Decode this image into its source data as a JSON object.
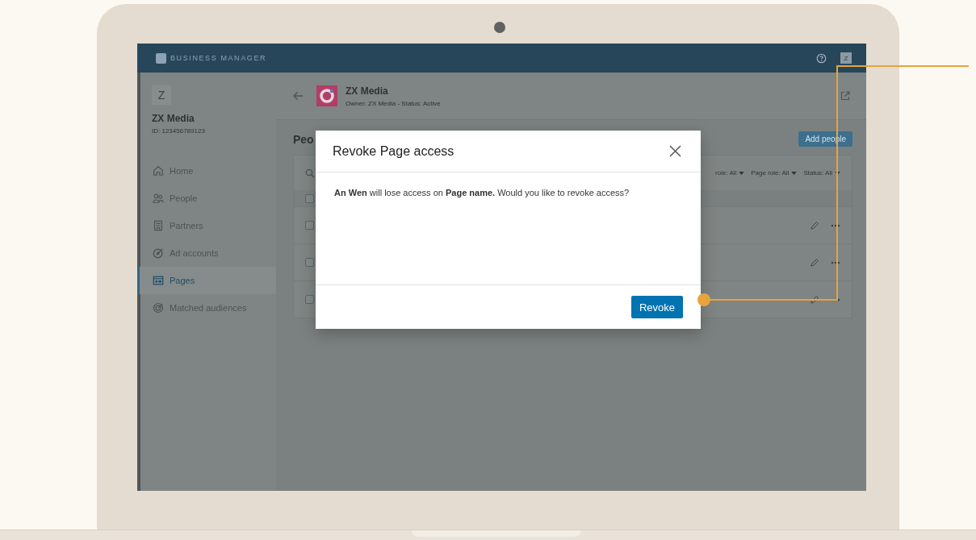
{
  "topbar": {
    "brand": "BUSINESS MANAGER",
    "avatar": "Z"
  },
  "account": {
    "initial": "Z",
    "name": "ZX Media",
    "id": "ID: 123456789123"
  },
  "nav": [
    {
      "label": "Home",
      "kind": "home",
      "selected": false
    },
    {
      "label": "People",
      "kind": "people",
      "selected": false
    },
    {
      "label": "Partners",
      "kind": "building",
      "selected": false
    },
    {
      "label": "Ad accounts",
      "kind": "target",
      "selected": false
    },
    {
      "label": "Pages",
      "kind": "page",
      "selected": true
    },
    {
      "label": "Matched audiences",
      "kind": "audience",
      "selected": false
    }
  ],
  "page": {
    "title": "ZX Media",
    "meta": "Owner: ZX Media - Status: Active"
  },
  "section": {
    "title": "Peo",
    "add_button": "Add people"
  },
  "filters": [
    "role: All",
    "Page role: All",
    "Status: All"
  ],
  "table": {
    "header_checked": false,
    "rows": [
      {
        "checked": false
      },
      {
        "checked": false
      },
      {
        "checked": false
      }
    ]
  },
  "dialog": {
    "title": "Revoke Page access",
    "message": "**An Wen** will lose access on **Page name.** Would you like to revoke access?",
    "confirm": "Revoke"
  }
}
